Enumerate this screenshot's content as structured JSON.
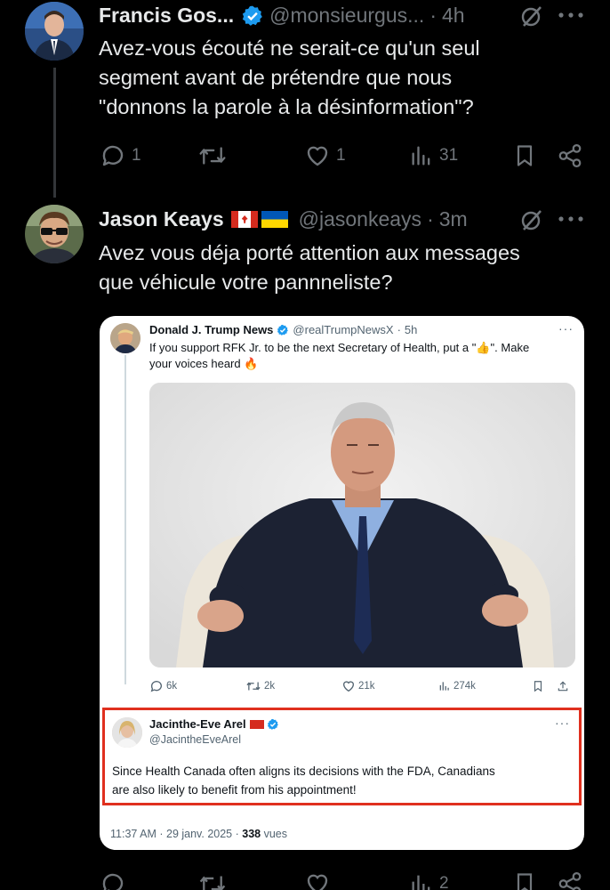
{
  "tweet1": {
    "name": "Francis Gos...",
    "handle": "@monsieurgus...",
    "separator": "·",
    "time": "4h",
    "text_lines": [
      "Avez-vous écouté ne serait-ce qu'un seul",
      "segment avant de prétendre que nous",
      "\"donnons la parole à la désinformation\"?"
    ],
    "actions": {
      "replies": "1",
      "retweets": "",
      "likes": "1",
      "views": "31"
    },
    "verified_color": "#1d9bf0"
  },
  "tweet2": {
    "name": "Jason Keays",
    "flags": [
      "canada-flag",
      "ukraine-flag"
    ],
    "handle": "@jasonkeays",
    "separator": "·",
    "time": "3m",
    "text_lines": [
      "Avez vous déja porté attention aux messages",
      "que véhicule votre pannneliste?"
    ],
    "actions": {
      "replies": "",
      "retweets": "",
      "likes": "",
      "views": "2"
    }
  },
  "embedded": {
    "author": "Donald J. Trump News",
    "handle": "@realTrumpNewsX",
    "separator": "·",
    "time": "5h",
    "text_lines": [
      "If you support RFK Jr. to be the next Secretary of Health, put a \"👍\". Make",
      "your voices heard 🔥"
    ],
    "actions": {
      "replies": "6k",
      "retweets": "2k",
      "likes": "21k",
      "views": "274k"
    },
    "quote": {
      "name": "Jacinthe-Eve Arel",
      "handle": "@JacintheEveArel",
      "text_lines": [
        "Since Health Canada often aligns its decisions with the FDA, Canadians",
        "are also likely to benefit from his appointment!"
      ],
      "highlight_color": "#e0301e"
    },
    "meta": {
      "time": "11:37 AM · 29 janv. 2025 ·",
      "views_count": "338",
      "views_label": "vues"
    }
  },
  "colors": {
    "background": "#000000",
    "text": "#e7e9ea",
    "muted": "#71767b",
    "accent": "#1d9bf0"
  }
}
